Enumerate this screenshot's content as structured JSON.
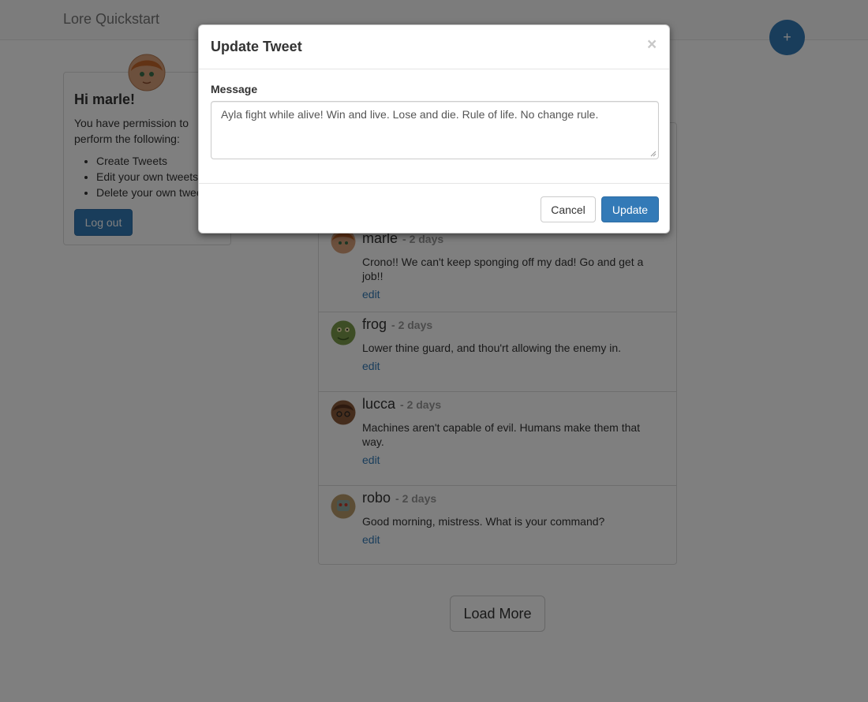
{
  "navbar": {
    "brand": "Lore Quickstart",
    "fab_label": "+",
    "fab_icon": "plus-icon"
  },
  "profile": {
    "greeting": "Hi marle!",
    "permissions_intro": "You have permission to perform the following:",
    "permissions": [
      "Create Tweets",
      "Edit your own tweets",
      "Delete your own tweets"
    ],
    "logout_label": "Log out",
    "avatar_icon": "user-avatar"
  },
  "tweets": [
    {
      "user": "marle",
      "time": "- 2 days",
      "text": "Crono!! We can't keep sponging off my dad! Go and get a job!!",
      "edit_label": "edit"
    },
    {
      "user": "frog",
      "time": "- 2 days",
      "text": "Lower thine guard, and thou'rt allowing the enemy in.",
      "edit_label": "edit"
    },
    {
      "user": "lucca",
      "time": "- 2 days",
      "text": "Machines aren't capable of evil. Humans make them that way.",
      "edit_label": "edit"
    },
    {
      "user": "robo",
      "time": "- 2 days",
      "text": "Good morning, mistress. What is your command?",
      "edit_label": "edit"
    }
  ],
  "load_more_label": "Load More",
  "modal": {
    "title": "Update Tweet",
    "close_label": "×",
    "field_label": "Message",
    "message_value": "Ayla fight while alive! Win and live. Lose and die. Rule of life. No change rule.",
    "cancel_label": "Cancel",
    "update_label": "Update"
  },
  "colors": {
    "primary": "#337ab7",
    "link": "#337ab7",
    "muted": "#999999",
    "backdrop": "rgba(0,0,0,0.5)"
  }
}
